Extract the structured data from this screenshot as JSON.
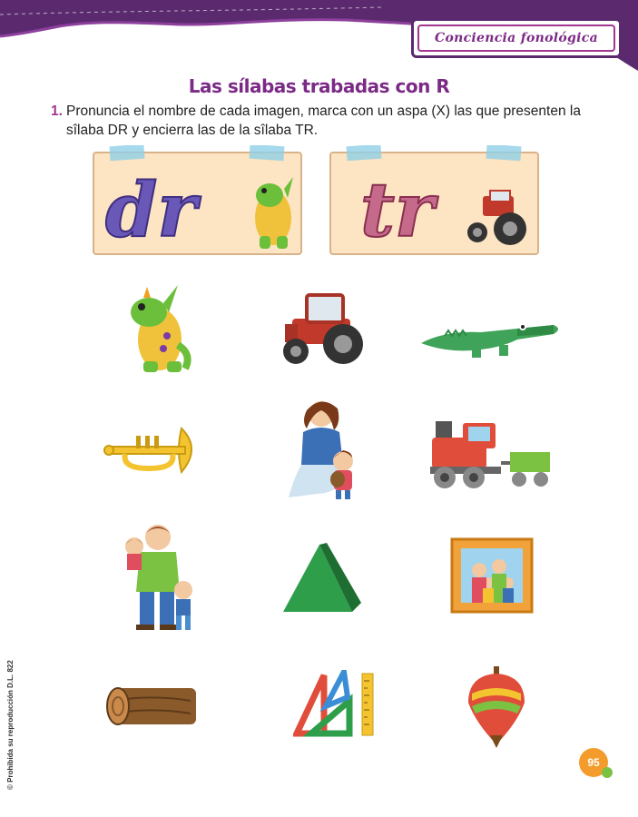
{
  "header": {
    "section_tag": "Conciencia fonológica"
  },
  "title": "Las sílabas trabadas con R",
  "exercise": {
    "number": "1.",
    "instruction": "Pronuncia el nombre de cada imagen, marca con un aspa (X) las que presenten la sîlaba DR y encierra las de la sîlaba TR."
  },
  "cards": [
    {
      "syllable": "dr",
      "picture": "dragon"
    },
    {
      "syllable": "tr",
      "picture": "tractor"
    }
  ],
  "grid": [
    {
      "picture": "dragon"
    },
    {
      "picture": "tractor"
    },
    {
      "picture": "crocodile"
    },
    {
      "picture": "trumpet"
    },
    {
      "picture": "mother-hugging-child"
    },
    {
      "picture": "train"
    },
    {
      "picture": "father-with-children"
    },
    {
      "picture": "triangle"
    },
    {
      "picture": "family-portrait"
    },
    {
      "picture": "log"
    },
    {
      "picture": "set-squares-ruler"
    },
    {
      "picture": "spinning-top"
    }
  ],
  "footer": {
    "copyright": "© Prohibida su reproducción D.L. 822",
    "page_number": "95"
  },
  "colors": {
    "brand_purple": "#7b2a86",
    "magenta": "#a2358f",
    "page_badge": "#f39c2b",
    "badge_dot": "#7cc242"
  }
}
